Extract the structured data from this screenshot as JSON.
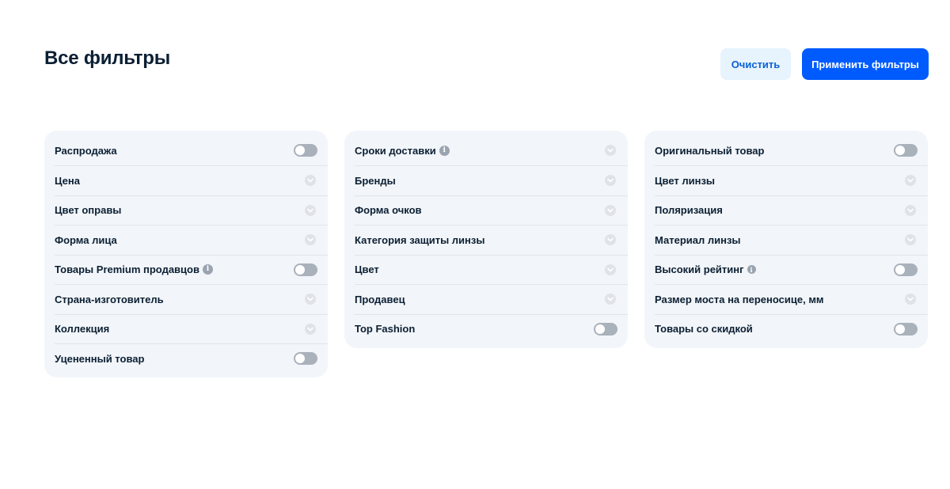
{
  "header": {
    "title": "Все фильтры",
    "clear_label": "Очистить",
    "apply_label": "Применить фильтры"
  },
  "colors": {
    "accent": "#005bff",
    "clear_bg": "#e7f3fd",
    "panel_bg": "#f2f5f9",
    "toggle_off": "#a9b1bb"
  },
  "columns": [
    {
      "items": [
        {
          "label": "Распродажа",
          "control": "toggle",
          "state": "off"
        },
        {
          "label": "Цена",
          "control": "chevron"
        },
        {
          "label": "Цвет оправы",
          "control": "chevron"
        },
        {
          "label": "Форма лица",
          "control": "chevron"
        },
        {
          "label": "Товары Premium продавцов",
          "control": "toggle",
          "state": "off",
          "info": true
        },
        {
          "label": "Страна-изготовитель",
          "control": "chevron"
        },
        {
          "label": "Коллекция",
          "control": "chevron"
        },
        {
          "label": "Уцененный товар",
          "control": "toggle",
          "state": "off"
        }
      ]
    },
    {
      "items": [
        {
          "label": "Сроки доставки",
          "control": "chevron",
          "info": true
        },
        {
          "label": "Бренды",
          "control": "chevron"
        },
        {
          "label": "Форма очков",
          "control": "chevron"
        },
        {
          "label": "Категория защиты линзы",
          "control": "chevron"
        },
        {
          "label": "Цвет",
          "control": "chevron"
        },
        {
          "label": "Продавец",
          "control": "chevron"
        },
        {
          "label": "Top Fashion",
          "control": "toggle",
          "state": "off"
        }
      ]
    },
    {
      "items": [
        {
          "label": "Оригинальный товар",
          "control": "toggle",
          "state": "off"
        },
        {
          "label": "Цвет линзы",
          "control": "chevron"
        },
        {
          "label": "Поляризация",
          "control": "chevron"
        },
        {
          "label": "Материал линзы",
          "control": "chevron"
        },
        {
          "label": "Высокий рейтинг",
          "control": "toggle",
          "state": "off",
          "info": true
        },
        {
          "label": "Размер моста на переносице, мм",
          "control": "chevron"
        },
        {
          "label": "Товары со скидкой",
          "control": "toggle",
          "state": "off"
        }
      ]
    }
  ]
}
